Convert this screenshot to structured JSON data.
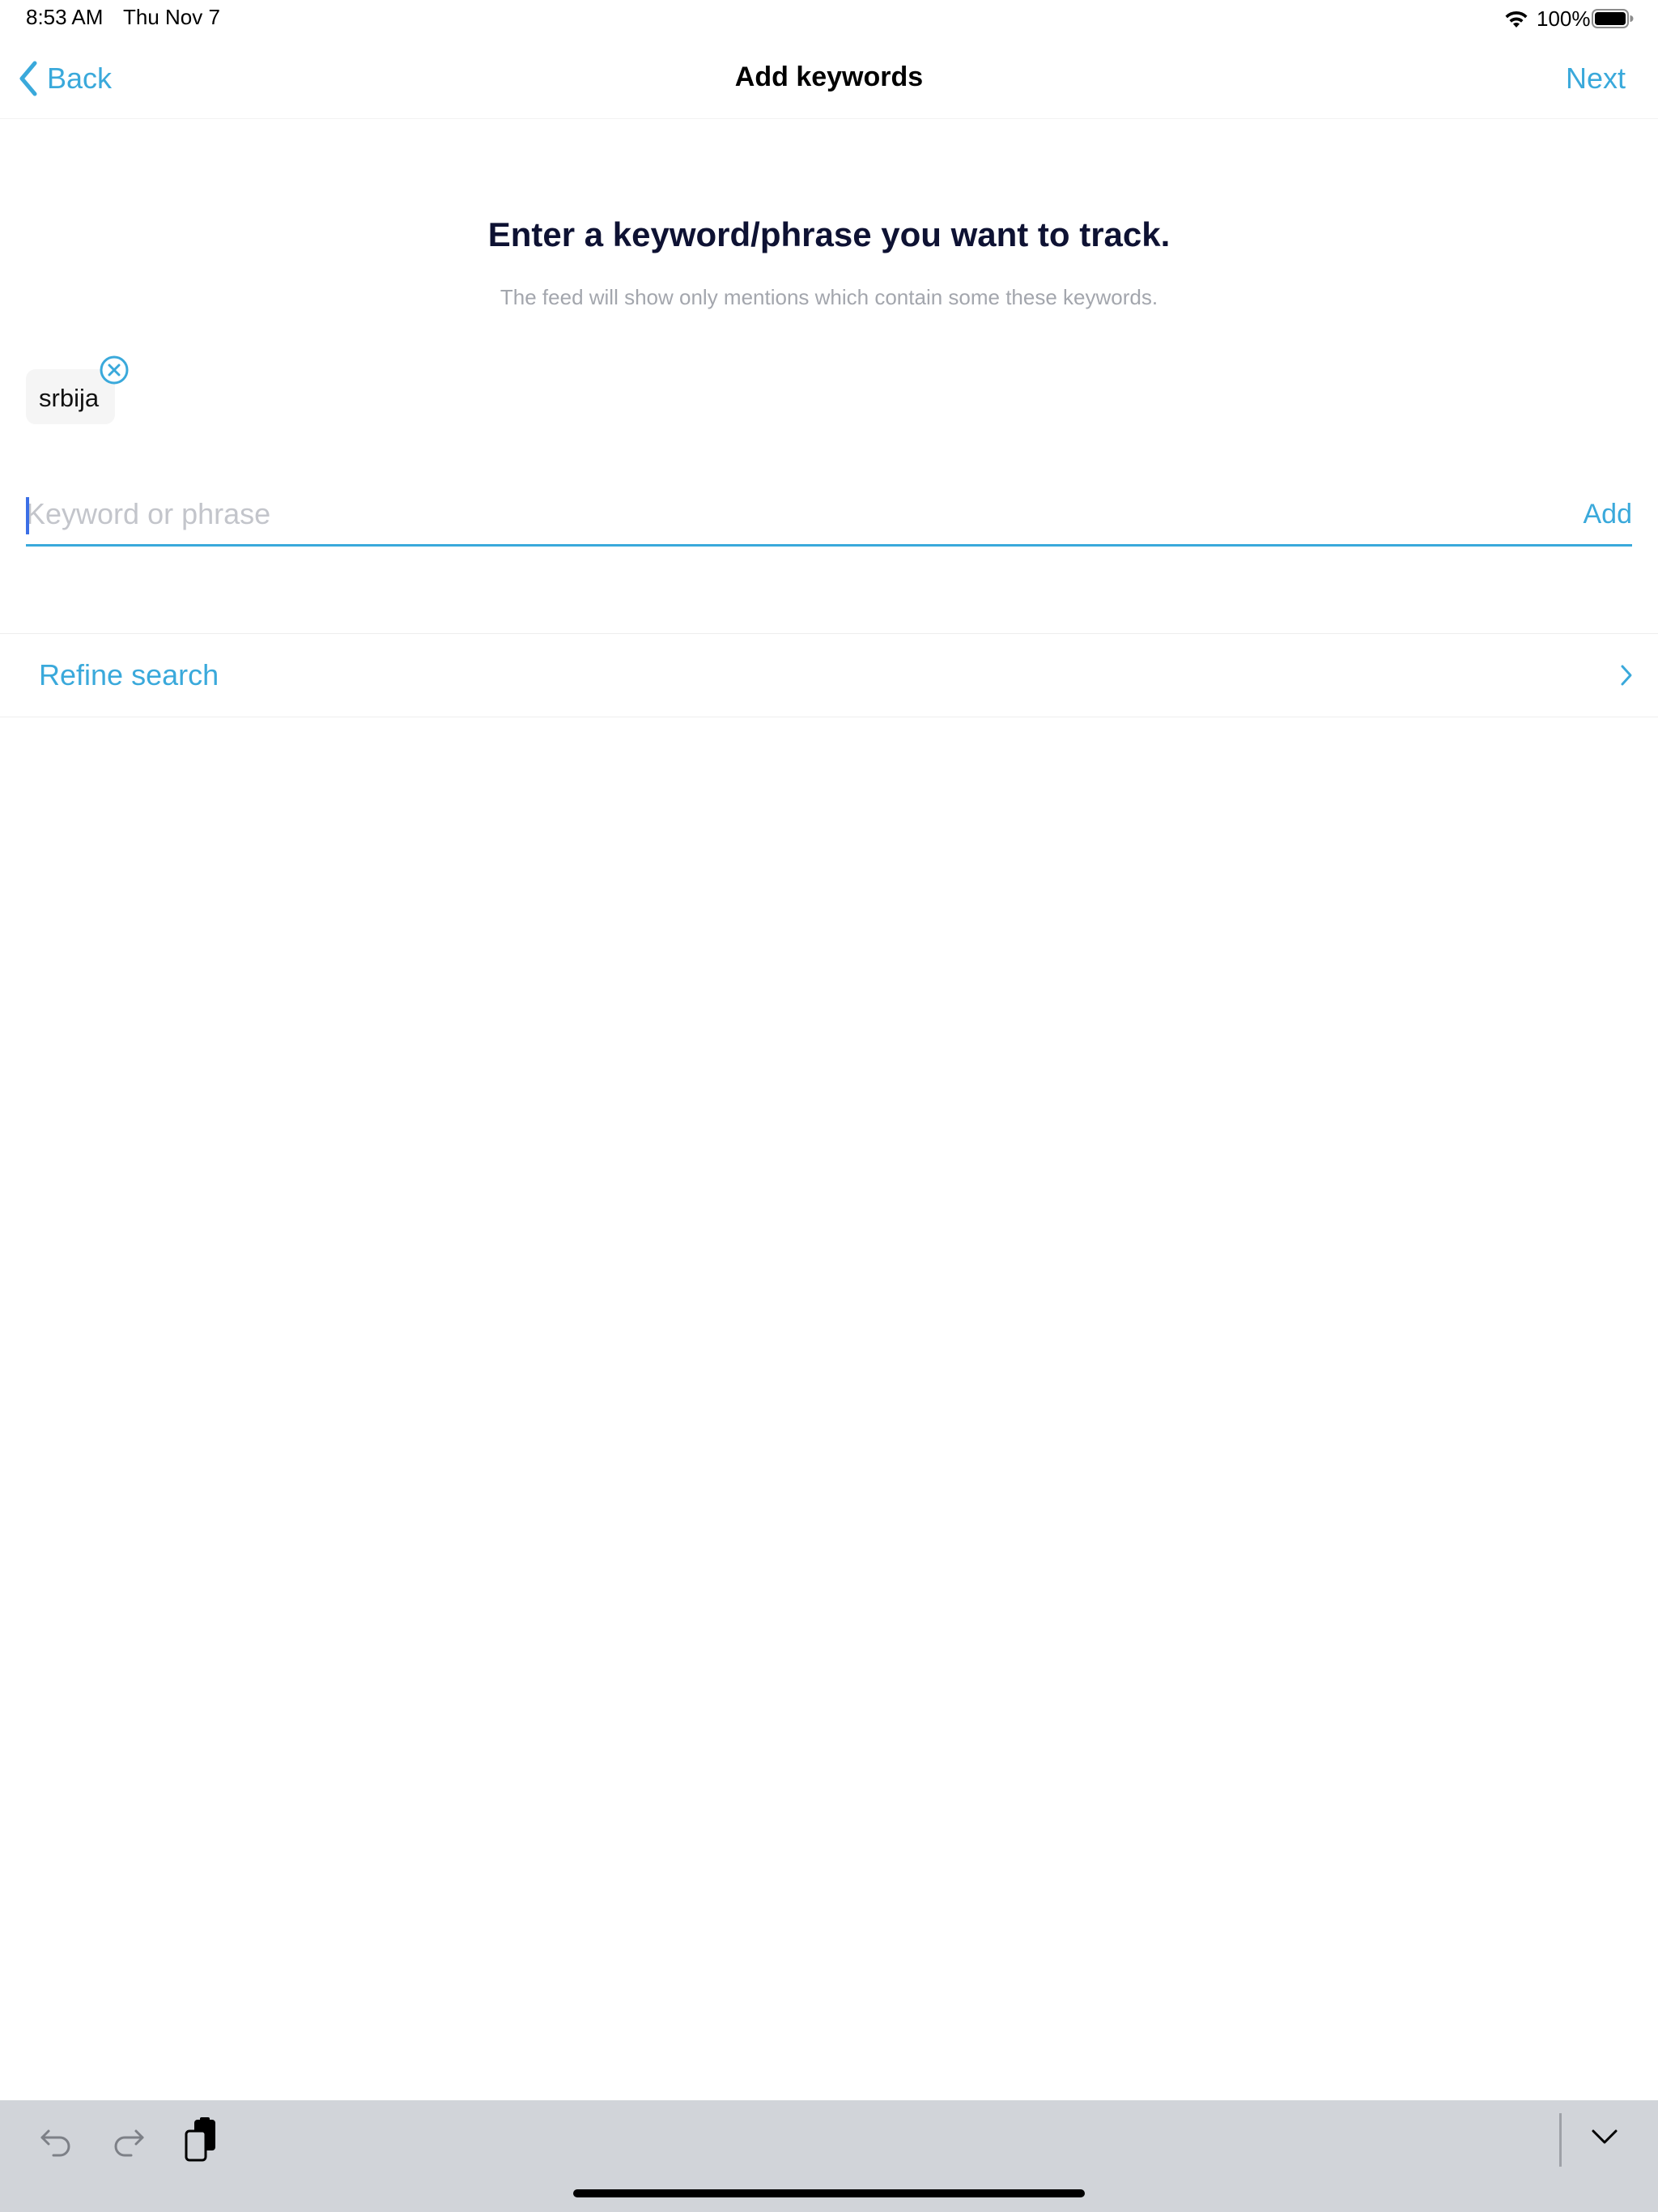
{
  "status_bar": {
    "time": "8:53 AM",
    "date": "Thu Nov 7",
    "battery_percent": "100%",
    "wifi_icon": "wifi-icon",
    "battery_icon": "battery-full-icon"
  },
  "nav": {
    "back_label": "Back",
    "back_icon": "chevron-left-icon",
    "title": "Add keywords",
    "next_label": "Next"
  },
  "main": {
    "headline": "Enter a keyword/phrase you want to track.",
    "subline": "The feed will show only mentions which contain some these keywords.",
    "keywords": [
      {
        "label": "srbija",
        "remove_icon": "close-circle-icon"
      }
    ],
    "input": {
      "value": "",
      "placeholder": "Keyword or phrase",
      "add_label": "Add"
    },
    "refine": {
      "label": "Refine search",
      "icon": "chevron-right-icon"
    }
  },
  "keyboard_bar": {
    "undo_icon": "undo-icon",
    "redo_icon": "redo-icon",
    "paste_icon": "paste-icon",
    "dismiss_icon": "chevron-down-icon"
  },
  "colors": {
    "accent": "#3aa9db",
    "headline": "#0e1233",
    "subline": "#a3a6ad",
    "placeholder": "#c3c5cb",
    "caret": "#3b6fe6",
    "chip_background": "#f5f5f5",
    "keyboard_bar": "#d1d4d9"
  }
}
